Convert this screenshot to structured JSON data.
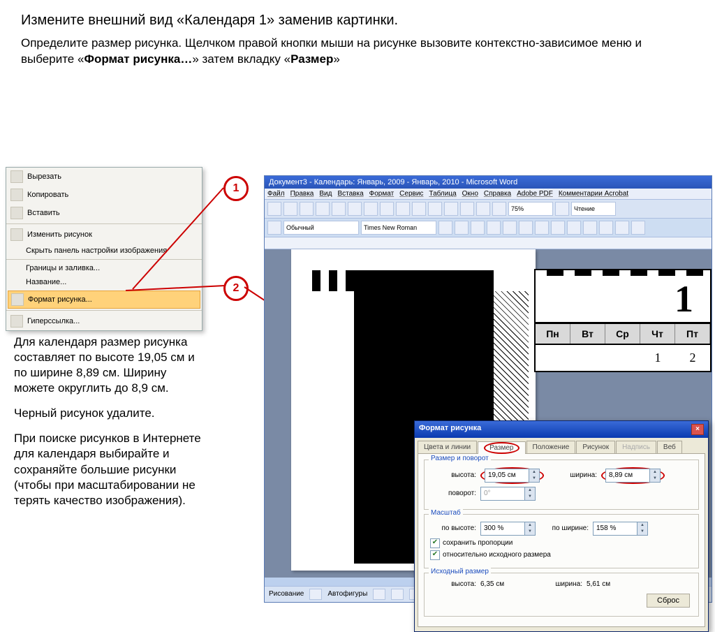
{
  "title": "Измените внешний вид «Календаря 1» заменив картинки.",
  "intro_1": "Определите размер рисунка. Щелчком правой кнопки мыши на рисунке вызовите контекстно-зависимое меню и выберите «",
  "intro_bold1": "Формат рисунка…",
  "intro_2": "» затем вкладку «",
  "intro_bold2": "Размер",
  "intro_3": "»",
  "ctx": {
    "cut": "Вырезать",
    "copy": "Копировать",
    "paste": "Вставить",
    "edit": "Изменить рисунок",
    "hide": "Скрыть панель настройки изображения",
    "border": "Границы и заливка...",
    "caption": "Название...",
    "format": "Формат рисунка...",
    "link": "Гиперссылка..."
  },
  "markers": {
    "m1": "1",
    "m2": "2"
  },
  "word": {
    "title": "Документ3 - Календарь: Январь, 2009 - Январь, 2010 - Microsoft Word",
    "menu": {
      "file": "Файл",
      "edit": "Правка",
      "view": "Вид",
      "insert": "Вставка",
      "format": "Формат",
      "tools": "Сервис",
      "table": "Таблица",
      "window": "Окно",
      "help": "Справка",
      "adobe": "Adobe PDF",
      "acrobat": "Комментарии Acrobat"
    },
    "style": "Обычный",
    "font": "Times New Roman",
    "zoom": "75%",
    "read": "Чтение",
    "drawing": "Рисование",
    "autoshapes": "Автофигуры"
  },
  "cal": {
    "big": "1",
    "days": [
      "Пн",
      "Вт",
      "Ср",
      "Чт",
      "Пт"
    ],
    "nums": [
      "",
      "",
      "",
      "1",
      "2"
    ]
  },
  "dlg": {
    "title": "Формат рисунка",
    "tabs": {
      "colors": "Цвета и линии",
      "size": "Размер",
      "position": "Положение",
      "picture": "Рисунок",
      "caption": "Надпись",
      "web": "Веб"
    },
    "grp1": "Размер и поворот",
    "height_l": "высота:",
    "height_v": "19,05 см",
    "width_l": "ширина:",
    "width_v": "8,89 см",
    "rot_l": "поворот:",
    "rot_v": "0°",
    "grp2": "Масштаб",
    "sh_l": "по высоте:",
    "sh_v": "300 %",
    "sw_l": "по ширине:",
    "sw_v": "158 %",
    "chk1": "сохранить пропорции",
    "chk2": "относительно исходного размера",
    "grp3": "Исходный размер",
    "oh": "высота:",
    "oh_v": "6,35 см",
    "ow": "ширина:",
    "ow_v": "5,61 см",
    "reset": "Сброс"
  },
  "left": {
    "p1": "Для календаря размер рисунка составляет по высоте 19,05 см и по ширине 8,89 см. Ширину можете округлить до 8,9 см.",
    "p2": "Черный рисунок удалите.",
    "p3": "При поиске рисунков в Интернете для календаря выбирайте и сохраняйте большие рисунки (чтобы при масштабировании не терять качество изображения)."
  }
}
